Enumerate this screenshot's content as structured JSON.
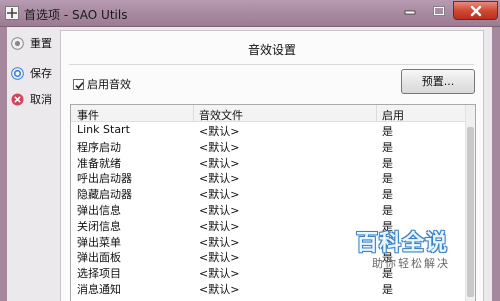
{
  "window": {
    "title": "首选项 - SAO Utils"
  },
  "sidebar": {
    "items": [
      {
        "label": "重置",
        "icon": "reset-icon"
      },
      {
        "label": "保存",
        "icon": "save-icon"
      },
      {
        "label": "取消",
        "icon": "cancel-icon"
      }
    ]
  },
  "panel": {
    "title": "音效设置",
    "enable_sound_label": "启用音效",
    "enable_sound_checked": true,
    "preset_button_label": "预置..."
  },
  "table": {
    "headers": [
      "事件",
      "音效文件",
      "启用"
    ],
    "rows": [
      {
        "event": "Link Start",
        "file": "<默认>",
        "enabled": "是"
      },
      {
        "event": "程序启动",
        "file": "<默认>",
        "enabled": "是"
      },
      {
        "event": "准备就绪",
        "file": "<默认>",
        "enabled": "是"
      },
      {
        "event": "呼出启动器",
        "file": "<默认>",
        "enabled": "是"
      },
      {
        "event": "隐藏启动器",
        "file": "<默认>",
        "enabled": "是"
      },
      {
        "event": "弹出信息",
        "file": "<默认>",
        "enabled": "是"
      },
      {
        "event": "关闭信息",
        "file": "<默认>",
        "enabled": "是"
      },
      {
        "event": "弹出菜单",
        "file": "<默认>",
        "enabled": "是"
      },
      {
        "event": "弹出面板",
        "file": "<默认>",
        "enabled": "是"
      },
      {
        "event": "选择项目",
        "file": "<默认>",
        "enabled": "是"
      },
      {
        "event": "消息通知",
        "file": "<默认>",
        "enabled": "是"
      }
    ]
  },
  "watermark": {
    "main": "百科全说",
    "sub": "助你轻松解决"
  },
  "colors": {
    "accent_blue": "#3a7fd0",
    "cancel_red": "#d0465e",
    "close_red": "#cf4b35"
  }
}
